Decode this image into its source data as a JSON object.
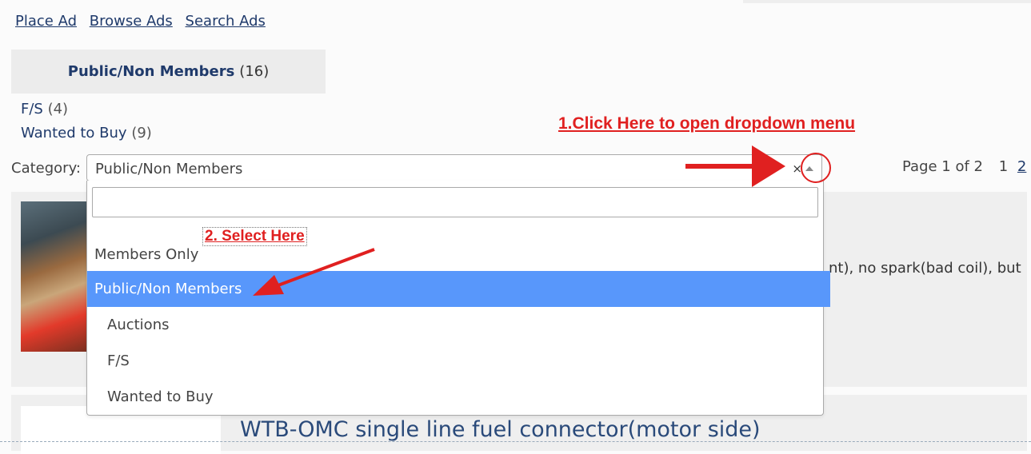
{
  "nav": {
    "links": [
      "Place Ad",
      "Browse Ads",
      "Search Ads"
    ]
  },
  "category_box": {
    "name": "Public/Non Members",
    "count": "(16)"
  },
  "sub_categories": [
    {
      "name": "F/S",
      "count": "(4)"
    },
    {
      "name": "Wanted to Buy",
      "count": "(9)"
    }
  ],
  "filter": {
    "label": "Category:",
    "selected": "Public/Non Members",
    "clear_symbol": "×",
    "search_value": "",
    "options": [
      {
        "label": "Members Only",
        "level": "group",
        "selected": false
      },
      {
        "label": "Public/Non Members",
        "level": "group",
        "selected": true
      },
      {
        "label": "Auctions",
        "level": "child",
        "selected": false
      },
      {
        "label": "F/S",
        "level": "child",
        "selected": false
      },
      {
        "label": "Wanted to Buy",
        "level": "child",
        "selected": false
      }
    ]
  },
  "pager": {
    "label": "Page 1 of 2",
    "pages": [
      "1",
      "2"
    ],
    "current": "1"
  },
  "ads": [
    {
      "snippet": "nt), no spark(bad coil), but"
    },
    {
      "title": "WTB-OMC single line fuel connector(motor side)"
    }
  ],
  "annotations": {
    "step1": "1.Click Here to open dropdown menu",
    "step2": "2. Select Here"
  },
  "colors": {
    "link": "#1f3a6b",
    "highlight": "#5897fb",
    "annotation": "#e02020"
  }
}
